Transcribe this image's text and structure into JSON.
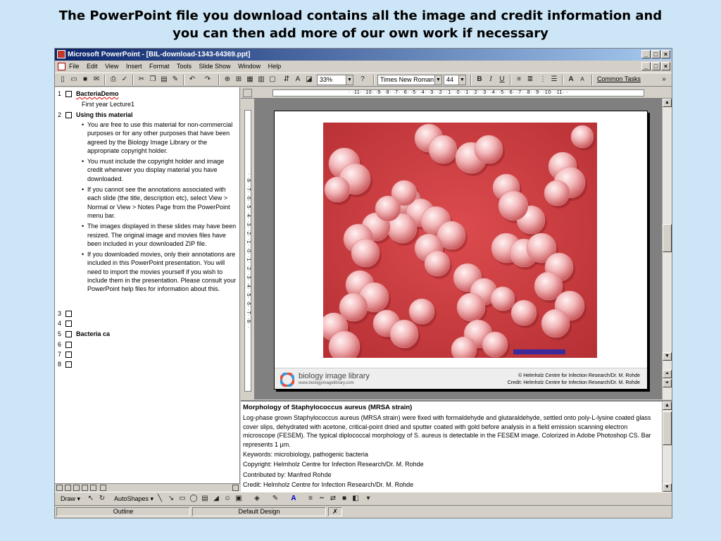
{
  "heading": {
    "line1": "The PowerPoint file you download contains all the image and credit information and",
    "line2": "you can then add more of our own work if necessary"
  },
  "window": {
    "title": "Microsoft PowerPoint - [BIL-download-1343-64369.ppt]",
    "controls": [
      "_",
      "□",
      "×"
    ]
  },
  "menu": [
    "File",
    "Edit",
    "View",
    "Insert",
    "Format",
    "Tools",
    "Slide Show",
    "Window",
    "Help"
  ],
  "toolbar": {
    "zoom": "33%",
    "font_name": "Times New Roman",
    "font_size": "44",
    "bold": "B",
    "italic": "I",
    "underline": "U",
    "common_tasks": "Common Tasks"
  },
  "outline": {
    "slide1": {
      "num": "1",
      "title": "BacteriaDemo",
      "sub": "First year Lecture1"
    },
    "slide2": {
      "num": "2",
      "title": "Using this material",
      "bullets": [
        "You are free to use this material for non-commercial purposes or for any other purposes that have been agreed by the Biology Image Library or the appropriate copyright holder.",
        "You must include the copyright holder and image credit whenever you display material you have downloaded.",
        "If you cannot see the annotations associated with each slide (the title, description etc), select View > Normal or View > Notes Page from the PowerPoint menu bar.",
        "The images displayed in these slides may have been resized. The original image and movies files have been included in your downloaded ZIP file.",
        "If you downloaded movies, only their annotations are included in this PowerPoint presentation. You will need to import the movies yourself if you wish to include them in the presentation. Please consult your PowerPoint help files for information about this."
      ]
    },
    "slide3": {
      "num": "3"
    },
    "slide4": {
      "num": "4"
    },
    "slide5": {
      "num": "5",
      "title": "Bacteria ca"
    },
    "slide6": {
      "num": "6"
    },
    "slide7": {
      "num": "7"
    },
    "slide8": {
      "num": "8"
    }
  },
  "ruler": {
    "h": "· ·11· ·10· ·9· ·8· ·7· ·6· ·5· ·4· ·3· ·2· ·1· ·0· ·1· ·2· ·3· ·4· ·5· ·6· ·7· ·8· ·9· ·10· ·11· ·",
    "v": "· ·8· ·7· ·6· ·5· ·4· ·3· ·2· ·1· ·0· ·1· ·2· ·3· ·4· ·5· ·6· ·7· ·8· ·"
  },
  "slide": {
    "logo_name": "biology image library",
    "logo_url": "www.biologyimagelibrary.com",
    "copyright": "© Helmholz Centre for Infection Research/Dr. M. Rohde",
    "credit": "Credit: Helmholz Centre for Infection Research/Dr. M. Rohde"
  },
  "notes": {
    "title": "Morphology of Staphylococcus aureus (MRSA strain)",
    "description": "Log-phase grown Staphylococcus aureus (MRSA strain) were fixed with formaldehyde and glutaraldehyde, settled onto poly-L-lysine coated glass cover slips, dehydrated with acetone, critical-point dried and sputter coated with gold before analysis in a field emission scanning electron microscope (FESEM). The typical diplococcal morphology of S. aureus is detectable in the FESEM image. Colorized in Adobe Photoshop CS. Bar represents 1 µm.",
    "keywords": "Keywords: microbiology, pathogenic bacteria",
    "copyright": "Copyright: Helmholz Centre for Infection Research/Dr. M. Rohde",
    "contributed": "Contributed by: Manfred Rohde",
    "credit": "Credit: Helmholz Centre for Infection Research/Dr. M. Rohde"
  },
  "drawbar": {
    "draw": "Draw",
    "autoshapes": "AutoShapes"
  },
  "status": {
    "outline": "Outline",
    "design": "Default Design"
  },
  "colors": {
    "title_start": "#0a246a",
    "title_end": "#a6caf0",
    "chrome": "#d4d0c8",
    "micro_bg": "#c8393c",
    "scale_bar": "#3b2a9a"
  }
}
